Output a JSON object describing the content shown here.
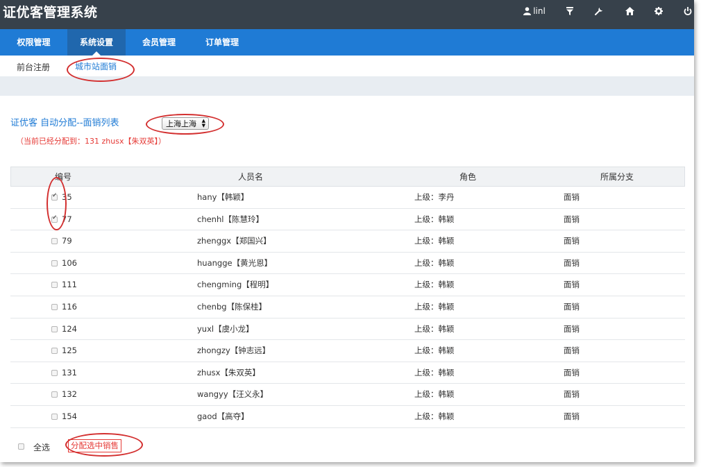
{
  "app_title": "证优客管理系统",
  "header": {
    "user_name": "linl",
    "icons": [
      "user-icon",
      "filter-icon",
      "wrench-icon",
      "home-icon",
      "gear-icon",
      "power-icon"
    ]
  },
  "main_nav": {
    "tabs": [
      {
        "label": "权限管理",
        "active": false
      },
      {
        "label": "系统设置",
        "active": true
      },
      {
        "label": "会员管理",
        "active": false
      },
      {
        "label": "订单管理",
        "active": false
      }
    ]
  },
  "sub_nav": {
    "items": [
      {
        "label": "前台注册",
        "active": false
      },
      {
        "label": "城市站面销",
        "active": true
      }
    ]
  },
  "list": {
    "title": "证优客 自动分配--面销列表",
    "city_select": {
      "selected": "上海上海"
    },
    "assign_note": "（当前已经分配到：131 zhusx【朱双英】）"
  },
  "table": {
    "headers": [
      "编号",
      "人员名",
      "角色",
      "所属分支"
    ],
    "rows": [
      {
        "id": "35",
        "name": "hany【韩颖】",
        "role": "上级：李丹",
        "branch": "面销",
        "checked": true
      },
      {
        "id": "77",
        "name": "chenhl【陈慧玲】",
        "role": "上级：韩颖",
        "branch": "面销",
        "checked": true
      },
      {
        "id": "79",
        "name": "zhenggx【郑国兴】",
        "role": "上级：韩颖",
        "branch": "面销",
        "checked": false
      },
      {
        "id": "106",
        "name": "huangge【黄光恩】",
        "role": "上级：韩颖",
        "branch": "面销",
        "checked": false
      },
      {
        "id": "111",
        "name": "chengming【程明】",
        "role": "上级：韩颖",
        "branch": "面销",
        "checked": false
      },
      {
        "id": "116",
        "name": "chenbg【陈保桂】",
        "role": "上级：韩颖",
        "branch": "面销",
        "checked": false
      },
      {
        "id": "124",
        "name": "yuxl【虞小龙】",
        "role": "上级：韩颖",
        "branch": "面销",
        "checked": false
      },
      {
        "id": "125",
        "name": "zhongzy【钟志远】",
        "role": "上级：韩颖",
        "branch": "面销",
        "checked": false
      },
      {
        "id": "131",
        "name": "zhusx【朱双英】",
        "role": "上级：韩颖",
        "branch": "面销",
        "checked": false
      },
      {
        "id": "132",
        "name": "wangyy【汪义永】",
        "role": "上级：韩颖",
        "branch": "面销",
        "checked": false
      },
      {
        "id": "154",
        "name": "gaod【高夺】",
        "role": "上级：韩颖",
        "branch": "面销",
        "checked": false
      }
    ]
  },
  "footer": {
    "select_all_label": "全选",
    "assign_button_label": "分配选中销售"
  },
  "colors": {
    "topbar": "#37414b",
    "nav": "#1f7bd5",
    "nav_active": "#2067ad",
    "accent_red": "#e53935",
    "link_blue": "#1f7bd5"
  }
}
